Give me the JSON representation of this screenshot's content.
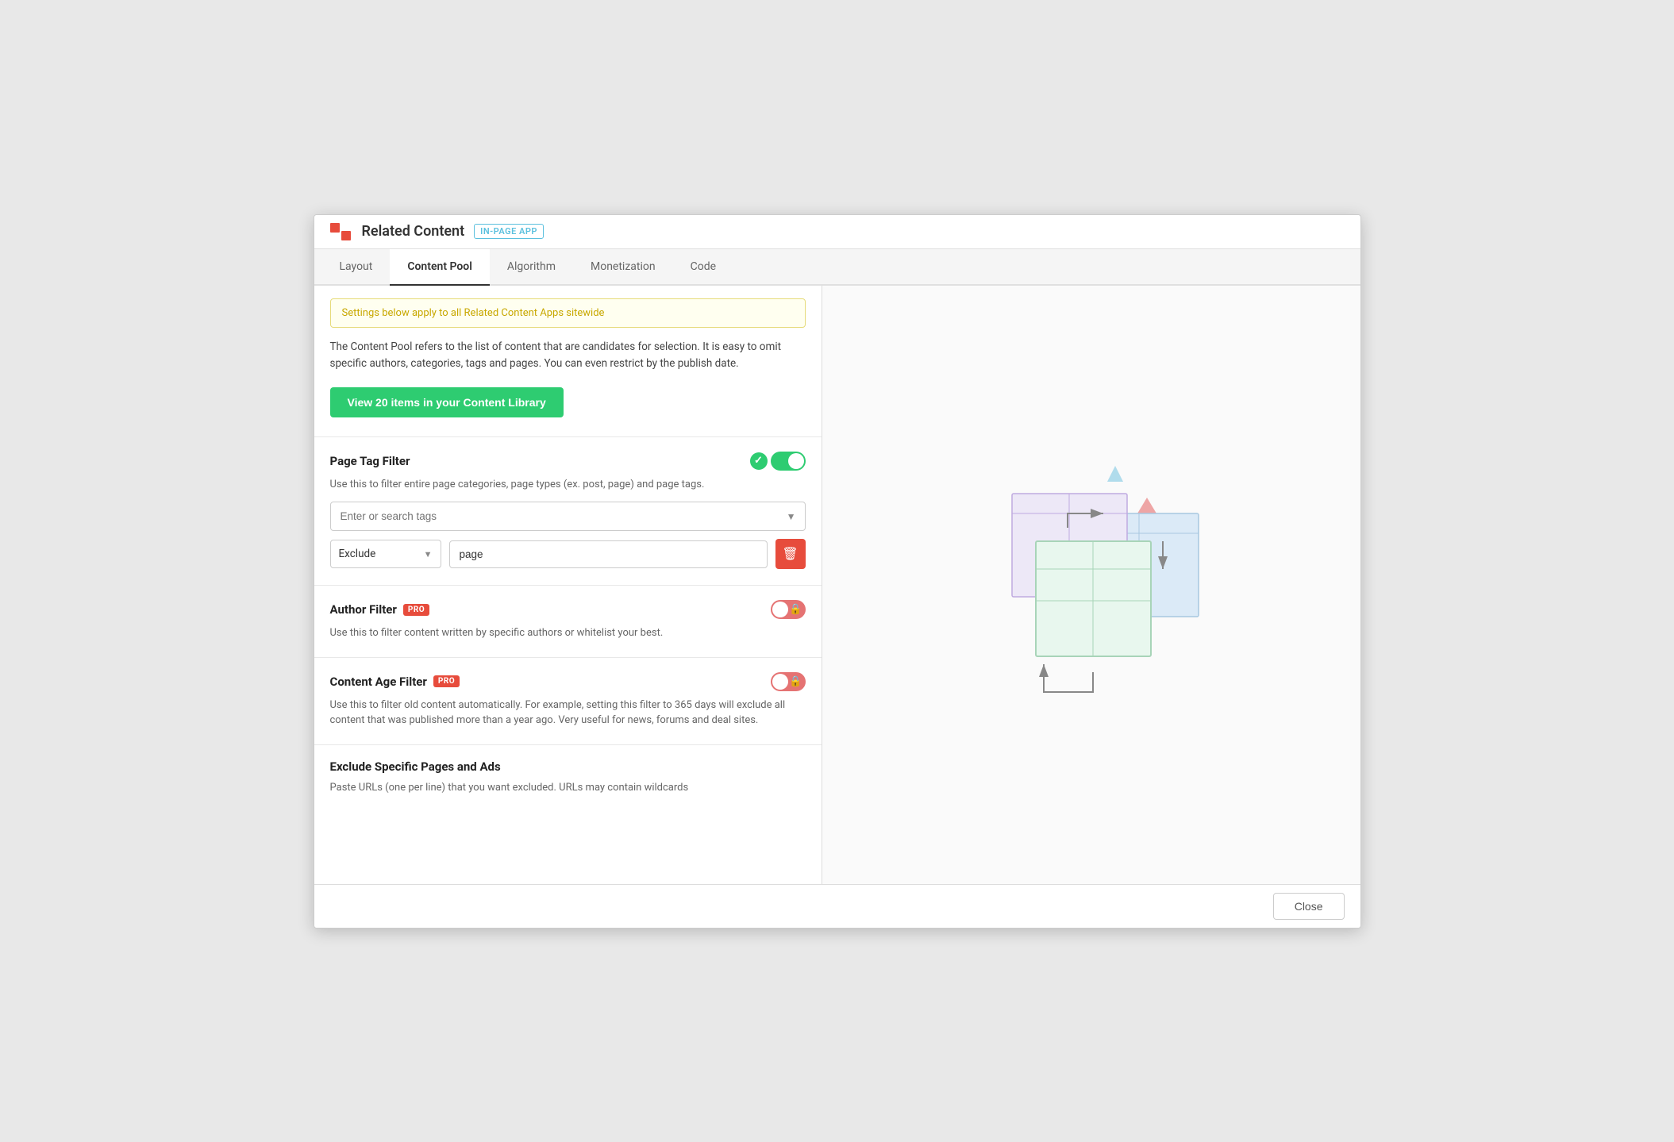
{
  "modal": {
    "title": "Related Content",
    "badge": "IN-PAGE APP"
  },
  "tabs": [
    {
      "id": "layout",
      "label": "Layout",
      "active": false
    },
    {
      "id": "content-pool",
      "label": "Content Pool",
      "active": true
    },
    {
      "id": "algorithm",
      "label": "Algorithm",
      "active": false
    },
    {
      "id": "monetization",
      "label": "Monetization",
      "active": false
    },
    {
      "id": "code",
      "label": "Code",
      "active": false
    }
  ],
  "notice": {
    "text": "Settings below apply to all Related Content Apps sitewide"
  },
  "description": "The Content Pool refers to the list of content that are candidates for selection. It is easy to omit specific authors, categories, tags and pages. You can even restrict by the publish date.",
  "view_library_button": "View 20 items in your Content Library",
  "page_tag_filter": {
    "title": "Page Tag Filter",
    "toggle_on": true,
    "description": "Use this to filter entire page categories, page types (ex. post, page) and page tags.",
    "search_placeholder": "Enter or search tags",
    "tag_row": {
      "mode": "Exclude",
      "value": "page",
      "delete_label": "🗑"
    }
  },
  "author_filter": {
    "title": "Author Filter",
    "pro": true,
    "toggle_on": false,
    "locked": true,
    "description": "Use this to filter content written by specific authors or whitelist your best."
  },
  "content_age_filter": {
    "title": "Content Age Filter",
    "pro": true,
    "toggle_on": false,
    "locked": true,
    "description": "Use this to filter old content automatically. For example, setting this filter to 365 days will exclude all content that was published more than a year ago. Very useful for news, forums and deal sites."
  },
  "exclude_pages": {
    "title": "Exclude Specific Pages and Ads",
    "description": "Paste URLs (one per line) that you want excluded. URLs may contain wildcards"
  },
  "footer": {
    "close_label": "Close"
  }
}
